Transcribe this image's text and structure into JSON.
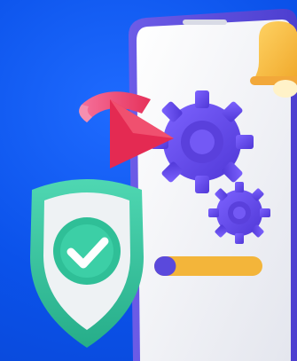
{
  "scene": {
    "subject": "phone-settings-security-illustration",
    "colors": {
      "background": "#0b52ea",
      "phone_body": "#f3f4f7",
      "phone_frame": "#5b4bd9",
      "gear": "#6a4ef0",
      "gear_dark": "#4a33c8",
      "arrow_pink": "#f2618f",
      "arrow_red": "#e5254d",
      "shield_teal": "#36c7a3",
      "shield_inner": "#e9eef0",
      "check_circle": "#2fbf97",
      "bell": "#f7c04a",
      "progress_fill": "#f6b93b",
      "progress_track": "#5c4cdf"
    },
    "progress_level": 0.2,
    "icons": [
      "gear-icon",
      "refresh-arrow-icon",
      "shield-check-icon",
      "bell-icon"
    ]
  }
}
